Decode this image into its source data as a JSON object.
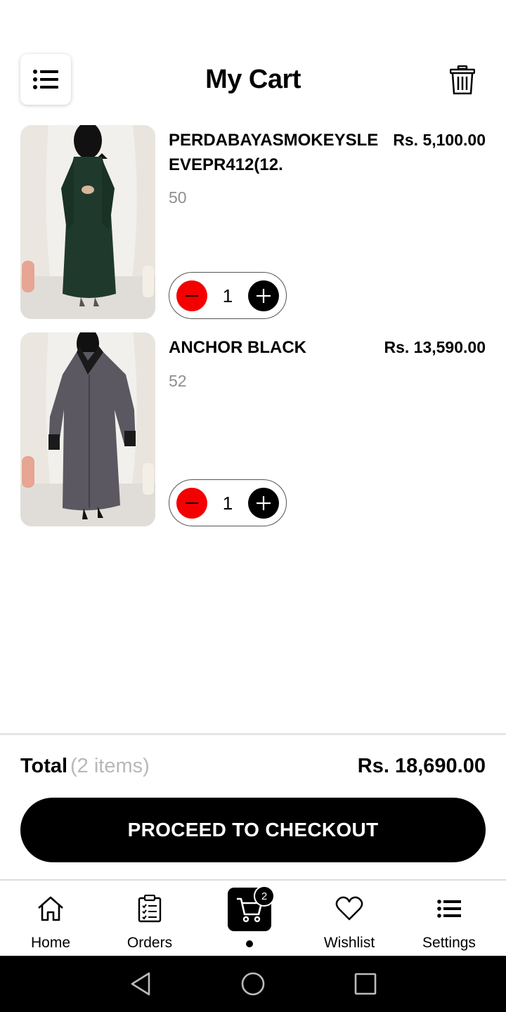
{
  "header": {
    "title": "My Cart",
    "menu_icon": "list-icon",
    "trash_icon": "trash-icon"
  },
  "cart": {
    "items": [
      {
        "name": "PERDABAYASMOKEYSLEEVEPR412(12.",
        "price": "Rs. 5,100.00",
        "size": "50",
        "quantity": "1",
        "image": "green-abaya-product-photo",
        "image_color": "#1f3a2c"
      },
      {
        "name": "ANCHOR BLACK",
        "price": "Rs. 13,590.00",
        "size": "52",
        "quantity": "1",
        "image": "grey-abaya-product-photo",
        "image_color": "#5b5862"
      }
    ],
    "minus_icon": "minus-circle-icon",
    "plus_icon": "plus-circle-icon"
  },
  "summary": {
    "total_label": "Total",
    "total_count": "(2 items)",
    "total_value": "Rs. 18,690.00",
    "checkout_label": "PROCEED TO CHECKOUT"
  },
  "bottom_nav": {
    "items": [
      {
        "label": "Home",
        "icon": "home-icon"
      },
      {
        "label": "Orders",
        "icon": "clipboard-icon"
      },
      {
        "label": "",
        "icon": "cart-icon",
        "badge": "2",
        "active": true
      },
      {
        "label": "Wishlist",
        "icon": "heart-icon"
      },
      {
        "label": "Settings",
        "icon": "list-icon"
      }
    ]
  },
  "colors": {
    "accent": "#000000",
    "minus_button": "#f40000",
    "muted_text": "#8f8f8f"
  }
}
